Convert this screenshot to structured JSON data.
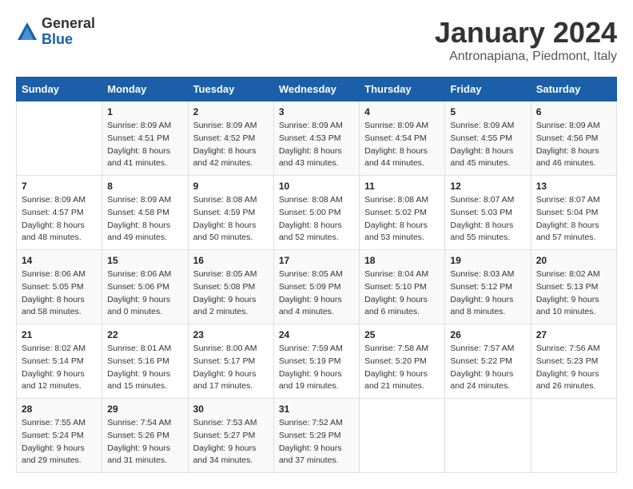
{
  "logo": {
    "general": "General",
    "blue": "Blue"
  },
  "title": "January 2024",
  "location": "Antronapiana, Piedmont, Italy",
  "headers": [
    "Sunday",
    "Monday",
    "Tuesday",
    "Wednesday",
    "Thursday",
    "Friday",
    "Saturday"
  ],
  "weeks": [
    [
      {
        "day": "",
        "info": ""
      },
      {
        "day": "1",
        "info": "Sunrise: 8:09 AM\nSunset: 4:51 PM\nDaylight: 8 hours\nand 41 minutes."
      },
      {
        "day": "2",
        "info": "Sunrise: 8:09 AM\nSunset: 4:52 PM\nDaylight: 8 hours\nand 42 minutes."
      },
      {
        "day": "3",
        "info": "Sunrise: 8:09 AM\nSunset: 4:53 PM\nDaylight: 8 hours\nand 43 minutes."
      },
      {
        "day": "4",
        "info": "Sunrise: 8:09 AM\nSunset: 4:54 PM\nDaylight: 8 hours\nand 44 minutes."
      },
      {
        "day": "5",
        "info": "Sunrise: 8:09 AM\nSunset: 4:55 PM\nDaylight: 8 hours\nand 45 minutes."
      },
      {
        "day": "6",
        "info": "Sunrise: 8:09 AM\nSunset: 4:56 PM\nDaylight: 8 hours\nand 46 minutes."
      }
    ],
    [
      {
        "day": "7",
        "info": "Sunrise: 8:09 AM\nSunset: 4:57 PM\nDaylight: 8 hours\nand 48 minutes."
      },
      {
        "day": "8",
        "info": "Sunrise: 8:09 AM\nSunset: 4:58 PM\nDaylight: 8 hours\nand 49 minutes."
      },
      {
        "day": "9",
        "info": "Sunrise: 8:08 AM\nSunset: 4:59 PM\nDaylight: 8 hours\nand 50 minutes."
      },
      {
        "day": "10",
        "info": "Sunrise: 8:08 AM\nSunset: 5:00 PM\nDaylight: 8 hours\nand 52 minutes."
      },
      {
        "day": "11",
        "info": "Sunrise: 8:08 AM\nSunset: 5:02 PM\nDaylight: 8 hours\nand 53 minutes."
      },
      {
        "day": "12",
        "info": "Sunrise: 8:07 AM\nSunset: 5:03 PM\nDaylight: 8 hours\nand 55 minutes."
      },
      {
        "day": "13",
        "info": "Sunrise: 8:07 AM\nSunset: 5:04 PM\nDaylight: 8 hours\nand 57 minutes."
      }
    ],
    [
      {
        "day": "14",
        "info": "Sunrise: 8:06 AM\nSunset: 5:05 PM\nDaylight: 8 hours\nand 58 minutes."
      },
      {
        "day": "15",
        "info": "Sunrise: 8:06 AM\nSunset: 5:06 PM\nDaylight: 9 hours\nand 0 minutes."
      },
      {
        "day": "16",
        "info": "Sunrise: 8:05 AM\nSunset: 5:08 PM\nDaylight: 9 hours\nand 2 minutes."
      },
      {
        "day": "17",
        "info": "Sunrise: 8:05 AM\nSunset: 5:09 PM\nDaylight: 9 hours\nand 4 minutes."
      },
      {
        "day": "18",
        "info": "Sunrise: 8:04 AM\nSunset: 5:10 PM\nDaylight: 9 hours\nand 6 minutes."
      },
      {
        "day": "19",
        "info": "Sunrise: 8:03 AM\nSunset: 5:12 PM\nDaylight: 9 hours\nand 8 minutes."
      },
      {
        "day": "20",
        "info": "Sunrise: 8:02 AM\nSunset: 5:13 PM\nDaylight: 9 hours\nand 10 minutes."
      }
    ],
    [
      {
        "day": "21",
        "info": "Sunrise: 8:02 AM\nSunset: 5:14 PM\nDaylight: 9 hours\nand 12 minutes."
      },
      {
        "day": "22",
        "info": "Sunrise: 8:01 AM\nSunset: 5:16 PM\nDaylight: 9 hours\nand 15 minutes."
      },
      {
        "day": "23",
        "info": "Sunrise: 8:00 AM\nSunset: 5:17 PM\nDaylight: 9 hours\nand 17 minutes."
      },
      {
        "day": "24",
        "info": "Sunrise: 7:59 AM\nSunset: 5:19 PM\nDaylight: 9 hours\nand 19 minutes."
      },
      {
        "day": "25",
        "info": "Sunrise: 7:58 AM\nSunset: 5:20 PM\nDaylight: 9 hours\nand 21 minutes."
      },
      {
        "day": "26",
        "info": "Sunrise: 7:57 AM\nSunset: 5:22 PM\nDaylight: 9 hours\nand 24 minutes."
      },
      {
        "day": "27",
        "info": "Sunrise: 7:56 AM\nSunset: 5:23 PM\nDaylight: 9 hours\nand 26 minutes."
      }
    ],
    [
      {
        "day": "28",
        "info": "Sunrise: 7:55 AM\nSunset: 5:24 PM\nDaylight: 9 hours\nand 29 minutes."
      },
      {
        "day": "29",
        "info": "Sunrise: 7:54 AM\nSunset: 5:26 PM\nDaylight: 9 hours\nand 31 minutes."
      },
      {
        "day": "30",
        "info": "Sunrise: 7:53 AM\nSunset: 5:27 PM\nDaylight: 9 hours\nand 34 minutes."
      },
      {
        "day": "31",
        "info": "Sunrise: 7:52 AM\nSunset: 5:29 PM\nDaylight: 9 hours\nand 37 minutes."
      },
      {
        "day": "",
        "info": ""
      },
      {
        "day": "",
        "info": ""
      },
      {
        "day": "",
        "info": ""
      }
    ]
  ]
}
